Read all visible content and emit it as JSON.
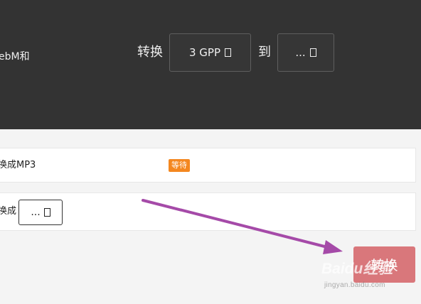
{
  "header": {
    "left_text": "ebM和",
    "convert_label": "转换",
    "from_format": "3 GPP",
    "to_label": "到",
    "to_format": "..."
  },
  "jobs": [
    {
      "text": "换成MP3",
      "status": "等待"
    },
    {
      "text": "换成",
      "format": "..."
    }
  ],
  "actions": {
    "convert_label": "转换"
  },
  "watermark": {
    "brand": "Baidu经验",
    "url": "jingyan.baidu.com"
  },
  "colors": {
    "header_bg": "#333333",
    "badge": "#f4871f",
    "button": "#d9777b",
    "arrow": "#a54aa8"
  },
  "icons": {
    "dropdown": "square-glyph-icon",
    "arrow": "purple-pointer-arrow"
  }
}
